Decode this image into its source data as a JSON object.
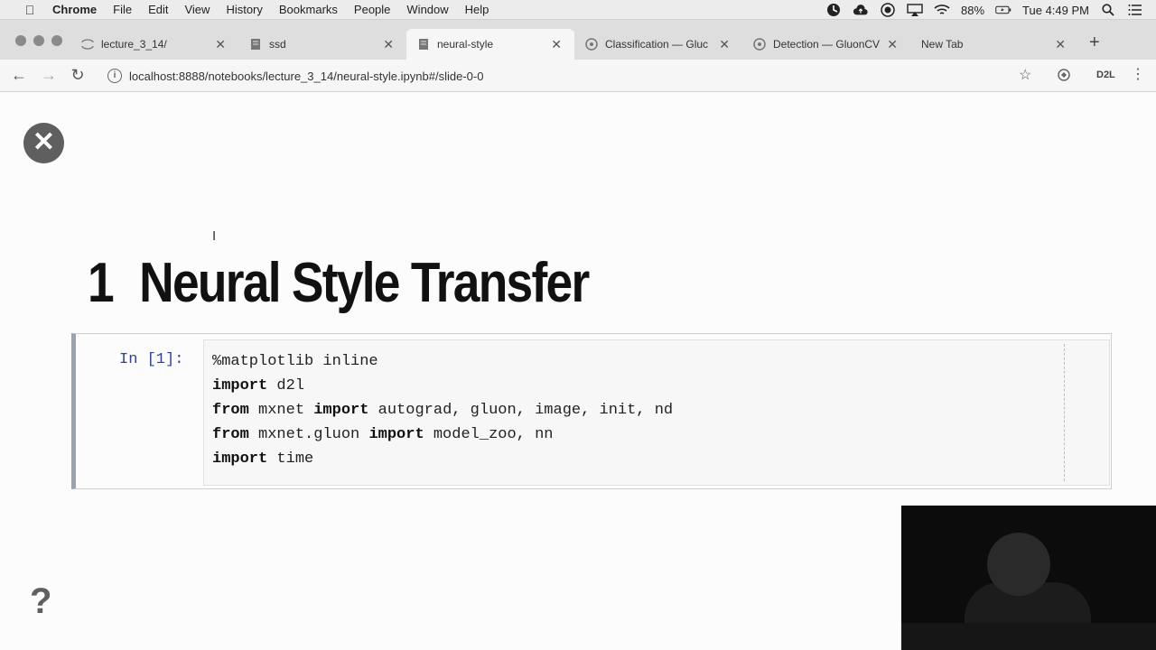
{
  "menubar": {
    "app": "Chrome",
    "items": [
      "File",
      "Edit",
      "View",
      "History",
      "Bookmarks",
      "People",
      "Window",
      "Help"
    ],
    "battery": "88%",
    "clock": "Tue 4:49 PM"
  },
  "tabs": [
    {
      "label": "lecture_3_14/",
      "icon": "jupyter-icon"
    },
    {
      "label": "ssd",
      "icon": "notebook-icon"
    },
    {
      "label": "neural-style",
      "icon": "notebook-icon",
      "active": true
    },
    {
      "label": "Classification — Gluc",
      "icon": "gluon-icon"
    },
    {
      "label": "Detection — GluonCV",
      "icon": "gluon-icon"
    },
    {
      "label": "New Tab",
      "icon": ""
    }
  ],
  "address": {
    "url": "localhost:8888/notebooks/lecture_3_14/neural-style.ipynb#/slide-0-0",
    "extension_label": "D2L"
  },
  "notebook": {
    "heading_number": "1",
    "heading_text": "Neural Style Transfer",
    "cell": {
      "prompt": "In [1]:",
      "lines": [
        [
          {
            "t": "%matplotlib inline",
            "k": false
          }
        ],
        [
          {
            "t": "import",
            "k": true
          },
          {
            "t": " d2l",
            "k": false
          }
        ],
        [
          {
            "t": "from",
            "k": true
          },
          {
            "t": " mxnet ",
            "k": false
          },
          {
            "t": "import",
            "k": true
          },
          {
            "t": " autograd, gluon, image, init, nd",
            "k": false
          }
        ],
        [
          {
            "t": "from",
            "k": true
          },
          {
            "t": " mxnet.gluon ",
            "k": false
          },
          {
            "t": "import",
            "k": true
          },
          {
            "t": " model_zoo, nn",
            "k": false
          }
        ],
        [
          {
            "t": "import",
            "k": true
          },
          {
            "t": " time",
            "k": false
          }
        ]
      ]
    }
  }
}
